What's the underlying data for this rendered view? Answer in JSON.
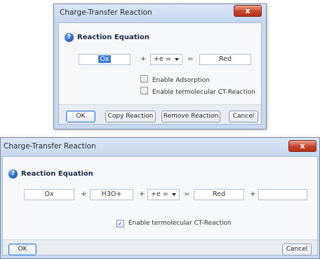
{
  "dialog1": {
    "title": "Charge-Transfer Reaction",
    "close_label": "x",
    "section_title": "Reaction Equation",
    "ox_value": "Ox",
    "plus1": "+",
    "electron_combo": "+e =",
    "equals": "=",
    "red_value": "Red",
    "checkbox_adsorption": "Enable Adsorption",
    "checkbox_termolecular": "Enable termolecular CT-Reaction",
    "buttons": {
      "ok": "OK",
      "copy": "Copy Reaction",
      "remove": "Remove Reaction",
      "cancel": "Cancel"
    }
  },
  "dialog2": {
    "title": "Charge-Transfer Reaction",
    "close_label": "x",
    "section_title": "Reaction Equation",
    "ox_value": "Ox",
    "plus1": "+",
    "h3o_value": "H3O+",
    "plus2": "+",
    "electron_combo": "+e =",
    "equals": "=",
    "red_value": "Red",
    "plus3": "+",
    "extra_value": "",
    "checkbox_termolecular": "Enable termolecular CT-Reaction",
    "checkbox_termolecular_checked": true,
    "buttons": {
      "ok": "OK",
      "cancel": "Cancel"
    }
  },
  "icons": {
    "help": "question-mark-icon",
    "dropdown": "chevron-down-icon",
    "close": "close-icon",
    "check": "checkmark-icon"
  },
  "colors": {
    "selection": "#3d7fd8",
    "close_button": "#c8432b",
    "window_frame": "#c8d9ef"
  }
}
